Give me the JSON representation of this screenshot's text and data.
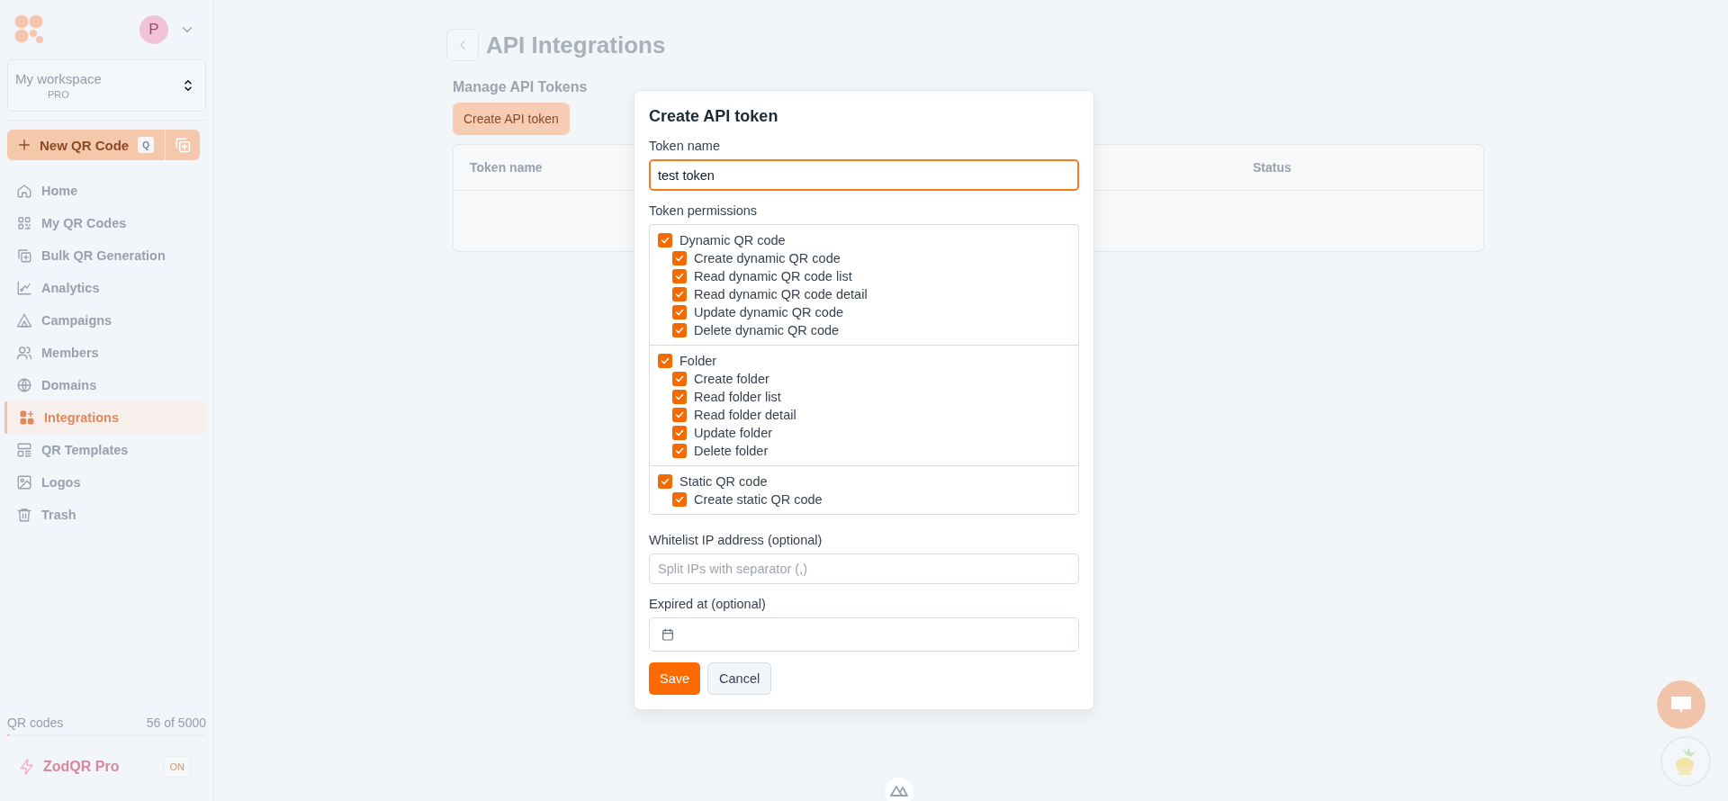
{
  "sidebar": {
    "avatar_initial": "P",
    "workspace": {
      "name": "My workspace",
      "plan": "PRO"
    },
    "new_button": {
      "label": "New QR Code",
      "shortcut": "Q"
    },
    "nav": [
      {
        "label": "Home",
        "selected": false
      },
      {
        "label": "My QR Codes",
        "selected": false
      },
      {
        "label": "Bulk QR Generation",
        "selected": false
      },
      {
        "label": "Analytics",
        "selected": false
      },
      {
        "label": "Campaigns",
        "selected": false
      },
      {
        "label": "Members",
        "selected": false
      },
      {
        "label": "Domains",
        "selected": false
      },
      {
        "label": "Integrations",
        "selected": true
      },
      {
        "label": "QR Templates",
        "selected": false
      },
      {
        "label": "Logos",
        "selected": false
      },
      {
        "label": "Trash",
        "selected": false
      }
    ],
    "usage": {
      "label": "QR codes",
      "count": "56 of 5000",
      "level": 0.0112
    },
    "pro": {
      "label": "ZodQR Pro",
      "badge": "ON"
    }
  },
  "main": {
    "title": "API Integrations",
    "section_title": "Manage API Tokens",
    "create_button": "Create API token",
    "table": {
      "columns": [
        "Token name",
        "Status"
      ]
    }
  },
  "modal": {
    "title": "Create API token",
    "token_name": {
      "label": "Token name",
      "value": "test token"
    },
    "permissions": {
      "label": "Token permissions",
      "groups": [
        {
          "label": "Dynamic QR code",
          "checked": true,
          "children": [
            {
              "label": "Create dynamic QR code",
              "checked": true
            },
            {
              "label": "Read dynamic QR code list",
              "checked": true
            },
            {
              "label": "Read dynamic QR code detail",
              "checked": true
            },
            {
              "label": "Update dynamic QR code",
              "checked": true
            },
            {
              "label": "Delete dynamic QR code",
              "checked": true
            }
          ]
        },
        {
          "label": "Folder",
          "checked": true,
          "children": [
            {
              "label": "Create folder",
              "checked": true
            },
            {
              "label": "Read folder list",
              "checked": true
            },
            {
              "label": "Read folder detail",
              "checked": true
            },
            {
              "label": "Update folder",
              "checked": true
            },
            {
              "label": "Delete folder",
              "checked": true
            }
          ]
        },
        {
          "label": "Static QR code",
          "checked": true,
          "children": [
            {
              "label": "Create static QR code",
              "checked": true
            }
          ]
        }
      ]
    },
    "whitelist": {
      "label": "Whitelist IP address (optional)",
      "placeholder": "Split IPs with separator (,)"
    },
    "expired": {
      "label": "Expired at (optional)"
    },
    "buttons": [
      {
        "label": "Save",
        "kind": "primary"
      },
      {
        "label": "Cancel",
        "kind": "secondary"
      }
    ]
  }
}
